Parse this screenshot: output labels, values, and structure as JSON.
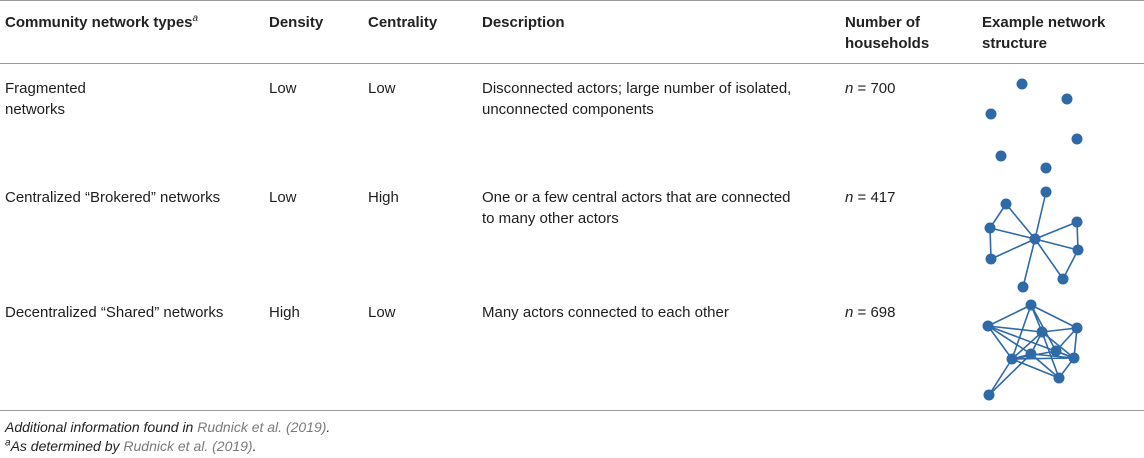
{
  "table": {
    "headers": {
      "col1": "Community network types",
      "col1_sup": "a",
      "col2": "Density",
      "col3": "Centrality",
      "col4": "Description",
      "col5_line1": "Number of",
      "col5_line2": "households",
      "col6_line1": "Example network",
      "col6_line2": "structure"
    },
    "rows": [
      {
        "type_line1": "Fragmented",
        "type_line2": "networks",
        "density": "Low",
        "centrality": "Low",
        "desc_line1": "Disconnected actors; large number of isolated,",
        "desc_line2": "unconnected components",
        "n_label": "n",
        "n_value": " = 700",
        "network": "fragmented"
      },
      {
        "type_line1": "Centralized “Brokered” networks",
        "type_line2": "",
        "density": "Low",
        "centrality": "High",
        "desc_line1": "One or a few central actors that are connected",
        "desc_line2": "to many other actors",
        "n_label": "n",
        "n_value": " = 417",
        "network": "centralized"
      },
      {
        "type_line1": "Decentralized “Shared” networks",
        "type_line2": "",
        "density": "High",
        "centrality": "Low",
        "desc_line1": "Many actors connected to each other",
        "desc_line2": "",
        "n_label": "n",
        "n_value": " = 698",
        "network": "decentralized"
      }
    ]
  },
  "footnotes": {
    "line1_text": "Additional information found in ",
    "line1_ref": "Rudnick et al. (2019)",
    "line1_end": ".",
    "line2_sup": "a",
    "line2_text": "As determined by ",
    "line2_ref": "Rudnick et al. (2019)",
    "line2_end": "."
  },
  "colors": {
    "node": "#2f6aa6",
    "reference_link": "#7a7a7a"
  }
}
